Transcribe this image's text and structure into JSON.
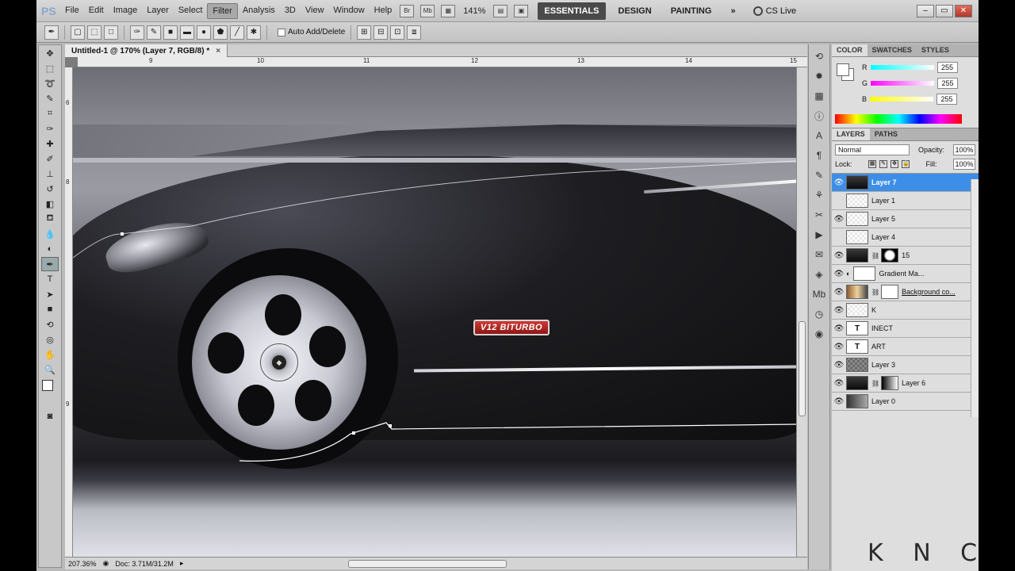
{
  "app": {
    "logo": "PS",
    "menu": [
      "File",
      "Edit",
      "Image",
      "Layer",
      "Select",
      "Filter",
      "Analysis",
      "3D",
      "View",
      "Window",
      "Help"
    ],
    "active_menu": "Filter",
    "zoom": "141%",
    "workspaces": [
      "ESSENTIALS",
      "DESIGN",
      "PAINTING"
    ],
    "more_workspaces": "»",
    "cs_live": "CS Live"
  },
  "options_bar": {
    "auto_add_delete": "Auto Add/Delete"
  },
  "document": {
    "tab_title": "Untitled-1 @ 170% (Layer 7, RGB/8) *",
    "tab_close": "×",
    "ruler_labels": [
      "9",
      "10",
      "11",
      "12",
      "13",
      "14",
      "15"
    ],
    "vruler_labels": [
      "6",
      "8",
      "9"
    ],
    "badge_text": "V12 BITURBO",
    "hub_logo": "◆"
  },
  "status": {
    "zoom": "207.36%",
    "doc_size": "Doc: 3.71M/31.2M"
  },
  "color_panel": {
    "tabs": [
      "COLOR",
      "SWATCHES",
      "STYLES"
    ],
    "channels": [
      {
        "label": "R",
        "value": "255",
        "color": "#ff0000"
      },
      {
        "label": "G",
        "value": "255",
        "color": "#00ff00"
      },
      {
        "label": "B",
        "value": "255",
        "color": "#0000ff"
      }
    ]
  },
  "layers_panel": {
    "tabs": [
      "LAYERS",
      "PATHS"
    ],
    "blend_mode": "Normal",
    "opacity_label": "Opacity:",
    "opacity": "100%",
    "lock_label": "Lock:",
    "fill_label": "Fill:",
    "fill": "100%",
    "layers": [
      {
        "name": "Layer 7",
        "visible": true,
        "thumb": "dark",
        "selected": true
      },
      {
        "name": "Layer 1",
        "visible": false,
        "thumb": "trans"
      },
      {
        "name": "Layer 5",
        "visible": true,
        "thumb": "trans"
      },
      {
        "name": "Layer 4",
        "visible": false,
        "thumb": "trans"
      },
      {
        "name": "15",
        "visible": true,
        "thumb": "dark",
        "mask": "shape"
      },
      {
        "name": "Gradient Ma...",
        "visible": true,
        "thumb": "white",
        "adjust": true
      },
      {
        "name": "Background co...",
        "visible": true,
        "thumb": "mixed",
        "mask": "blank",
        "underline": true
      },
      {
        "name": "K",
        "visible": true,
        "thumb": "trans"
      },
      {
        "name": "INECT",
        "visible": true,
        "thumb": "text",
        "text_glyph": "T"
      },
      {
        "name": "ART",
        "visible": true,
        "thumb": "text",
        "text_glyph": "T"
      },
      {
        "name": "Layer 3",
        "visible": true,
        "thumb": "grey"
      },
      {
        "name": "Layer 6",
        "visible": true,
        "thumb": "dark",
        "mask": "gradient"
      },
      {
        "name": "Layer 0",
        "visible": true,
        "thumb": "gradient"
      }
    ]
  },
  "watermark": "K  N  C  T",
  "colors": {
    "selection": "#3d8ee6",
    "ui_grey": "#c6c6c6"
  }
}
